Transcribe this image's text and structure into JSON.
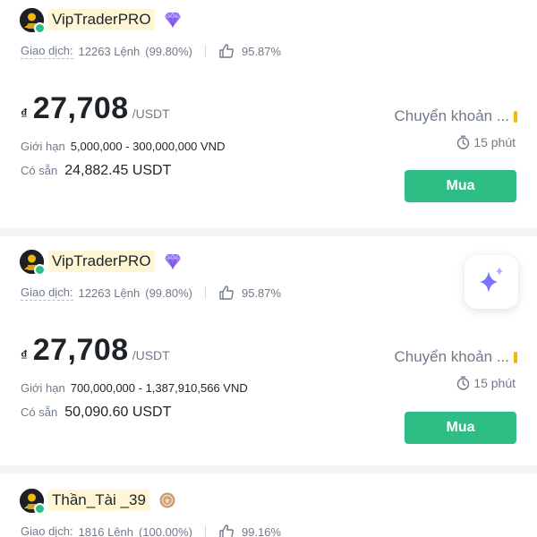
{
  "offers": [
    {
      "trader_name": "VipTraderPRO",
      "badge_icon": "diamond-icon",
      "trades_label": "Giao dịch:",
      "trades_value": "12263 Lệnh",
      "completion_rate": "(99.80%)",
      "positive_rate": "95.87%",
      "currency_symbol": "₫",
      "price": "27,708",
      "price_unit": "/USDT",
      "limit_label": "Giới hạn",
      "limit_value": "5,000,000 - 300,000,000 VND",
      "available_label": "Có sẵn",
      "available_value": "24,882.45 USDT",
      "payment_method": "Chuyển khoản ...",
      "payment_color": "#f0b90b",
      "time_limit": "15 phút",
      "buy_label": "Mua"
    },
    {
      "trader_name": "VipTraderPRO",
      "badge_icon": "diamond-icon",
      "trades_label": "Giao dịch:",
      "trades_value": "12263 Lệnh",
      "completion_rate": "(99.80%)",
      "positive_rate": "95.87%",
      "currency_symbol": "₫",
      "price": "27,708",
      "price_unit": "/USDT",
      "limit_label": "Giới hạn",
      "limit_value": "700,000,000 - 1,387,910,566 VND",
      "available_label": "Có sẵn",
      "available_value": "50,090.60 USDT",
      "payment_method": "Chuyển khoản ...",
      "payment_color": "#f0b90b",
      "time_limit": "15 phút",
      "buy_label": "Mua"
    },
    {
      "trader_name": "Thần_Tài _39",
      "badge_icon": "bronze-medal-icon",
      "trades_label": "Giao dịch:",
      "trades_value": "1816 Lệnh",
      "completion_rate": "(100.00%)",
      "positive_rate": "99.16%"
    }
  ],
  "ai_button_icon": "sparkle-icon",
  "colors": {
    "buy_green": "#2ebd85",
    "name_highlight": "#fff6d6",
    "diamond_purple": "#8f6cf3",
    "muted_text": "#707a8a"
  }
}
